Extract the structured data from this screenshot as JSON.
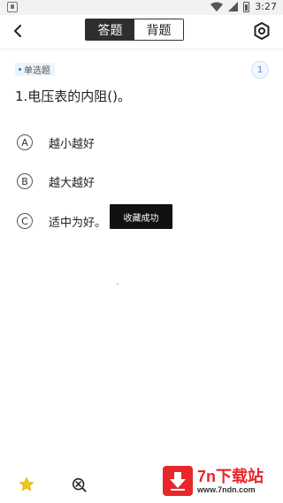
{
  "status_bar": {
    "time": "3:27",
    "icons": [
      "app-notification-icon",
      "wifi-icon",
      "signal-icon",
      "battery-icon"
    ]
  },
  "header": {
    "tabs": [
      {
        "label": "答题",
        "active": true
      },
      {
        "label": "背题",
        "active": false
      }
    ],
    "icons": [
      "back-arrow-icon",
      "settings-hexagon-icon"
    ]
  },
  "question": {
    "type_label": "单选题",
    "number": "1",
    "text": "1.电压表的内阻()。",
    "options": [
      {
        "letter": "A",
        "text": "越小越好"
      },
      {
        "letter": "B",
        "text": "越大越好"
      },
      {
        "letter": "C",
        "text": "适中为好。"
      }
    ]
  },
  "toast": {
    "text": "收藏成功"
  },
  "bottom_bar": {
    "icons": [
      "star-icon",
      "zoom-out-icon"
    ]
  },
  "watermark": {
    "brand": "7n下载站",
    "url": "www.7ndn.com"
  },
  "colors": {
    "accent_blue": "#3d7fd6",
    "segment_active_bg": "#2e2e2e",
    "star_yellow": "#f5c518",
    "watermark_red": "#e8262b",
    "toast_bg": "#111111"
  }
}
